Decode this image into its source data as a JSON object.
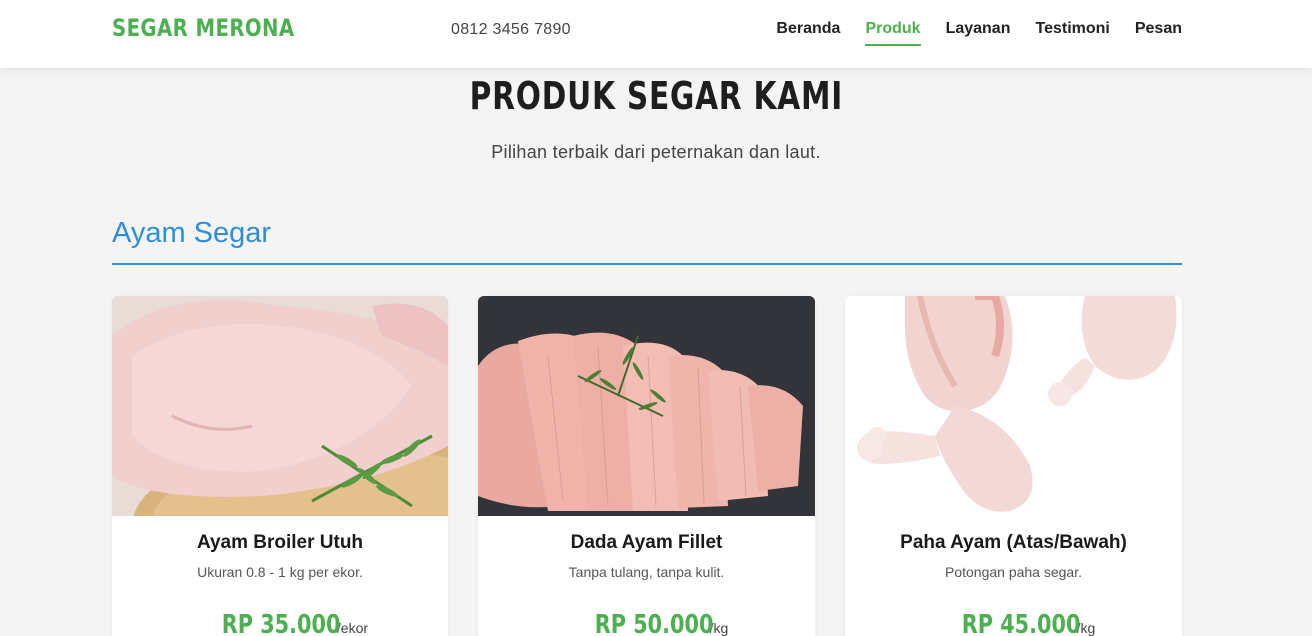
{
  "header": {
    "brand": "SEGAR MERONA",
    "phone": "0812 3456 7890",
    "nav": [
      "Beranda",
      "Produk",
      "Layanan",
      "Testimoni",
      "Pesan"
    ],
    "active_nav": "Produk"
  },
  "section": {
    "title": "PRODUK SEGAR KAMI",
    "subtitle": "Pilihan terbaik dari peternakan dan laut."
  },
  "category": {
    "title": "Ayam Segar",
    "accent_color": "#2e8fd8"
  },
  "products": [
    {
      "name": "Ayam Broiler Utuh",
      "desc": "Ukuran 0.8 - 1 kg per ekor.",
      "price": "RP 35.000",
      "unit": "/ekor",
      "image": "whole-chicken-photo"
    },
    {
      "name": "Dada Ayam Fillet",
      "desc": "Tanpa tulang, tanpa kulit.",
      "price": "RP 50.000",
      "unit": "/kg",
      "image": "chicken-fillet-photo"
    },
    {
      "name": "Paha Ayam (Atas/Bawah)",
      "desc": "Potongan paha segar.",
      "price": "RP 45.000",
      "unit": "/kg",
      "image": "chicken-drumstick-photo"
    }
  ],
  "colors": {
    "brand": "#4caf50",
    "background": "#f4f4f4"
  }
}
